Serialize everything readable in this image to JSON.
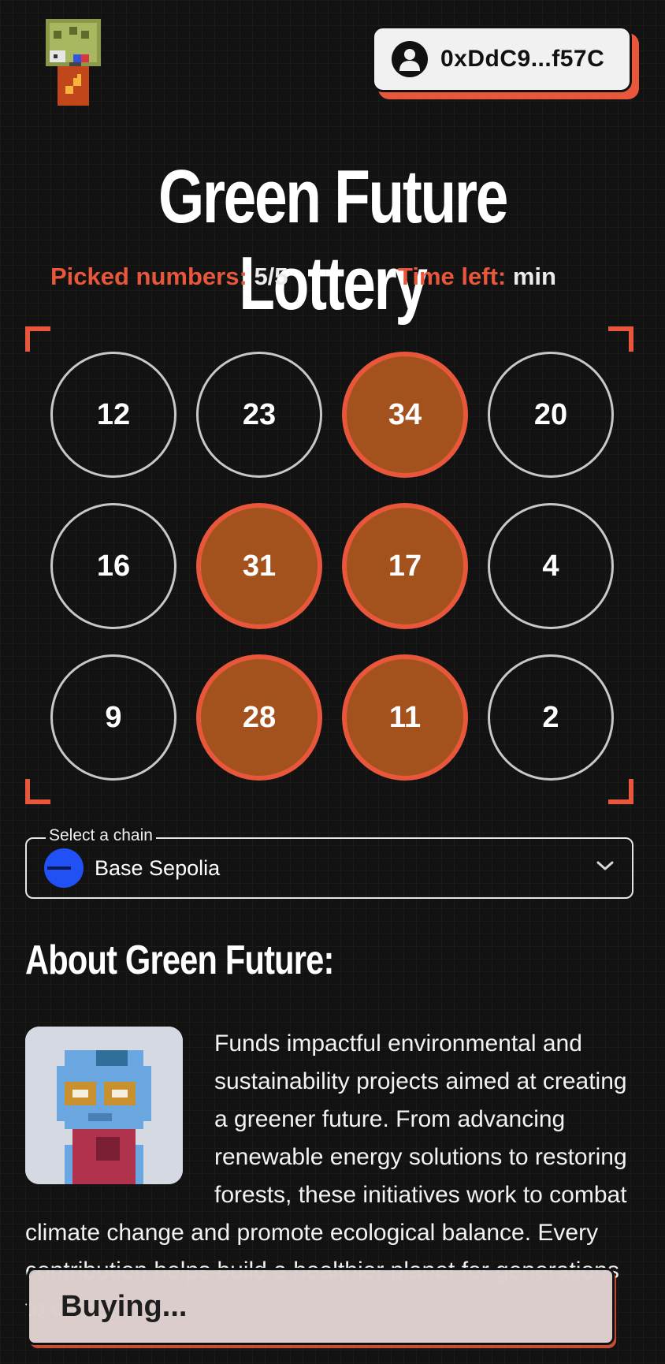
{
  "header": {
    "wallet_address": "0xDdC9...f57C",
    "logo_icon": "pixel-robot-logo-icon",
    "wallet_icon": "user-avatar-icon"
  },
  "title": "Green Future Lottery",
  "stats": {
    "picked_label": "Picked numbers:",
    "picked_value": "5/5",
    "time_label": "Time left:",
    "time_value": "min"
  },
  "numbers": [
    {
      "value": "12",
      "selected": false
    },
    {
      "value": "23",
      "selected": false
    },
    {
      "value": "34",
      "selected": true
    },
    {
      "value": "20",
      "selected": false
    },
    {
      "value": "16",
      "selected": false
    },
    {
      "value": "31",
      "selected": true
    },
    {
      "value": "17",
      "selected": true
    },
    {
      "value": "4",
      "selected": false
    },
    {
      "value": "9",
      "selected": false
    },
    {
      "value": "28",
      "selected": true
    },
    {
      "value": "11",
      "selected": true
    },
    {
      "value": "2",
      "selected": false
    }
  ],
  "chain_select": {
    "label": "Select a chain",
    "value": "Base Sepolia",
    "icon": "base-chain-icon"
  },
  "about": {
    "heading": "About Green Future:",
    "text": "Funds impactful environmental and sustainability projects aimed at creating a greener future. From advancing renewable energy solutions to restoring forests, these initiatives work to combat climate change and promote ecological balance. Every contribution helps build a healthier planet for generations to come.",
    "image_icon": "pixel-character-avatar-icon"
  },
  "toast": {
    "label": "Buying..."
  },
  "colors": {
    "accent": "#e8573b",
    "selected_fill": "#a4521d",
    "background": "#121212",
    "chain_blue": "#2151f5"
  }
}
